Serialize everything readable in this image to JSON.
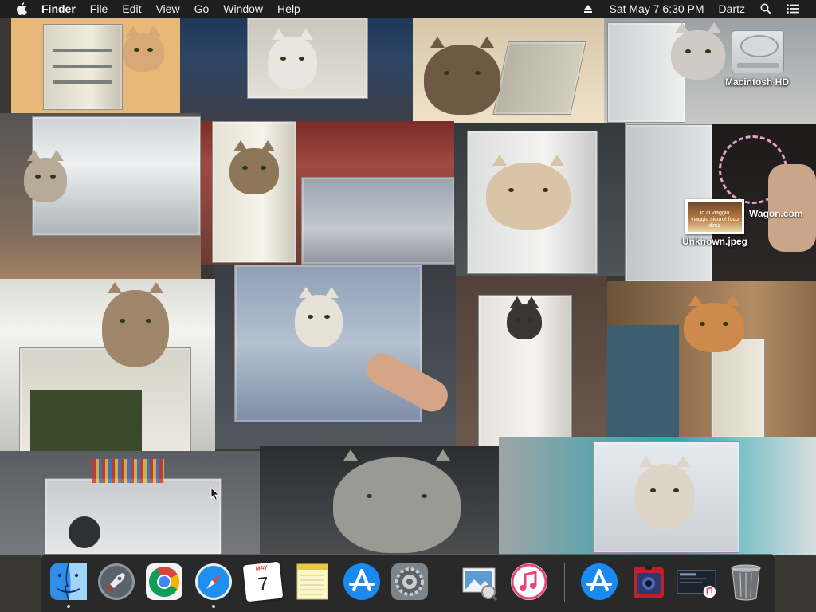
{
  "menubar": {
    "app_name": "Finder",
    "menus": [
      "File",
      "Edit",
      "View",
      "Go",
      "Window",
      "Help"
    ],
    "datetime": "Sat May 7  6:30 PM",
    "user": "Dartz",
    "icons": [
      "apple-icon",
      "eject-icon",
      "spotlight-search-icon",
      "notification-center-icon"
    ]
  },
  "desktop": {
    "icons": [
      {
        "label": "Macintosh HD",
        "type": "hard-drive-icon"
      },
      {
        "label": "Unknown.jpeg",
        "type": "image-file-icon",
        "thumb_caption": "io ci viaggio viaggio sicuro! foco dima"
      }
    ],
    "partial_label": "Wagon.com"
  },
  "dock": {
    "apps": [
      {
        "name": "Finder",
        "running": true
      },
      {
        "name": "Launchpad",
        "running": false
      },
      {
        "name": "Google Chrome",
        "running": false
      },
      {
        "name": "Safari",
        "running": true
      },
      {
        "name": "Calendar",
        "running": false,
        "month": "MAY",
        "day": "7"
      },
      {
        "name": "Notes",
        "running": false
      },
      {
        "name": "App Store",
        "running": false
      },
      {
        "name": "System Preferences",
        "running": false
      },
      {
        "name": "Preview",
        "running": false
      },
      {
        "name": "iTunes",
        "running": false
      },
      {
        "name": "App Store",
        "running": false
      },
      {
        "name": "Photo Booth",
        "running": false
      },
      {
        "name": "Recent Documents",
        "running": false
      },
      {
        "name": "Trash",
        "running": false
      }
    ]
  }
}
